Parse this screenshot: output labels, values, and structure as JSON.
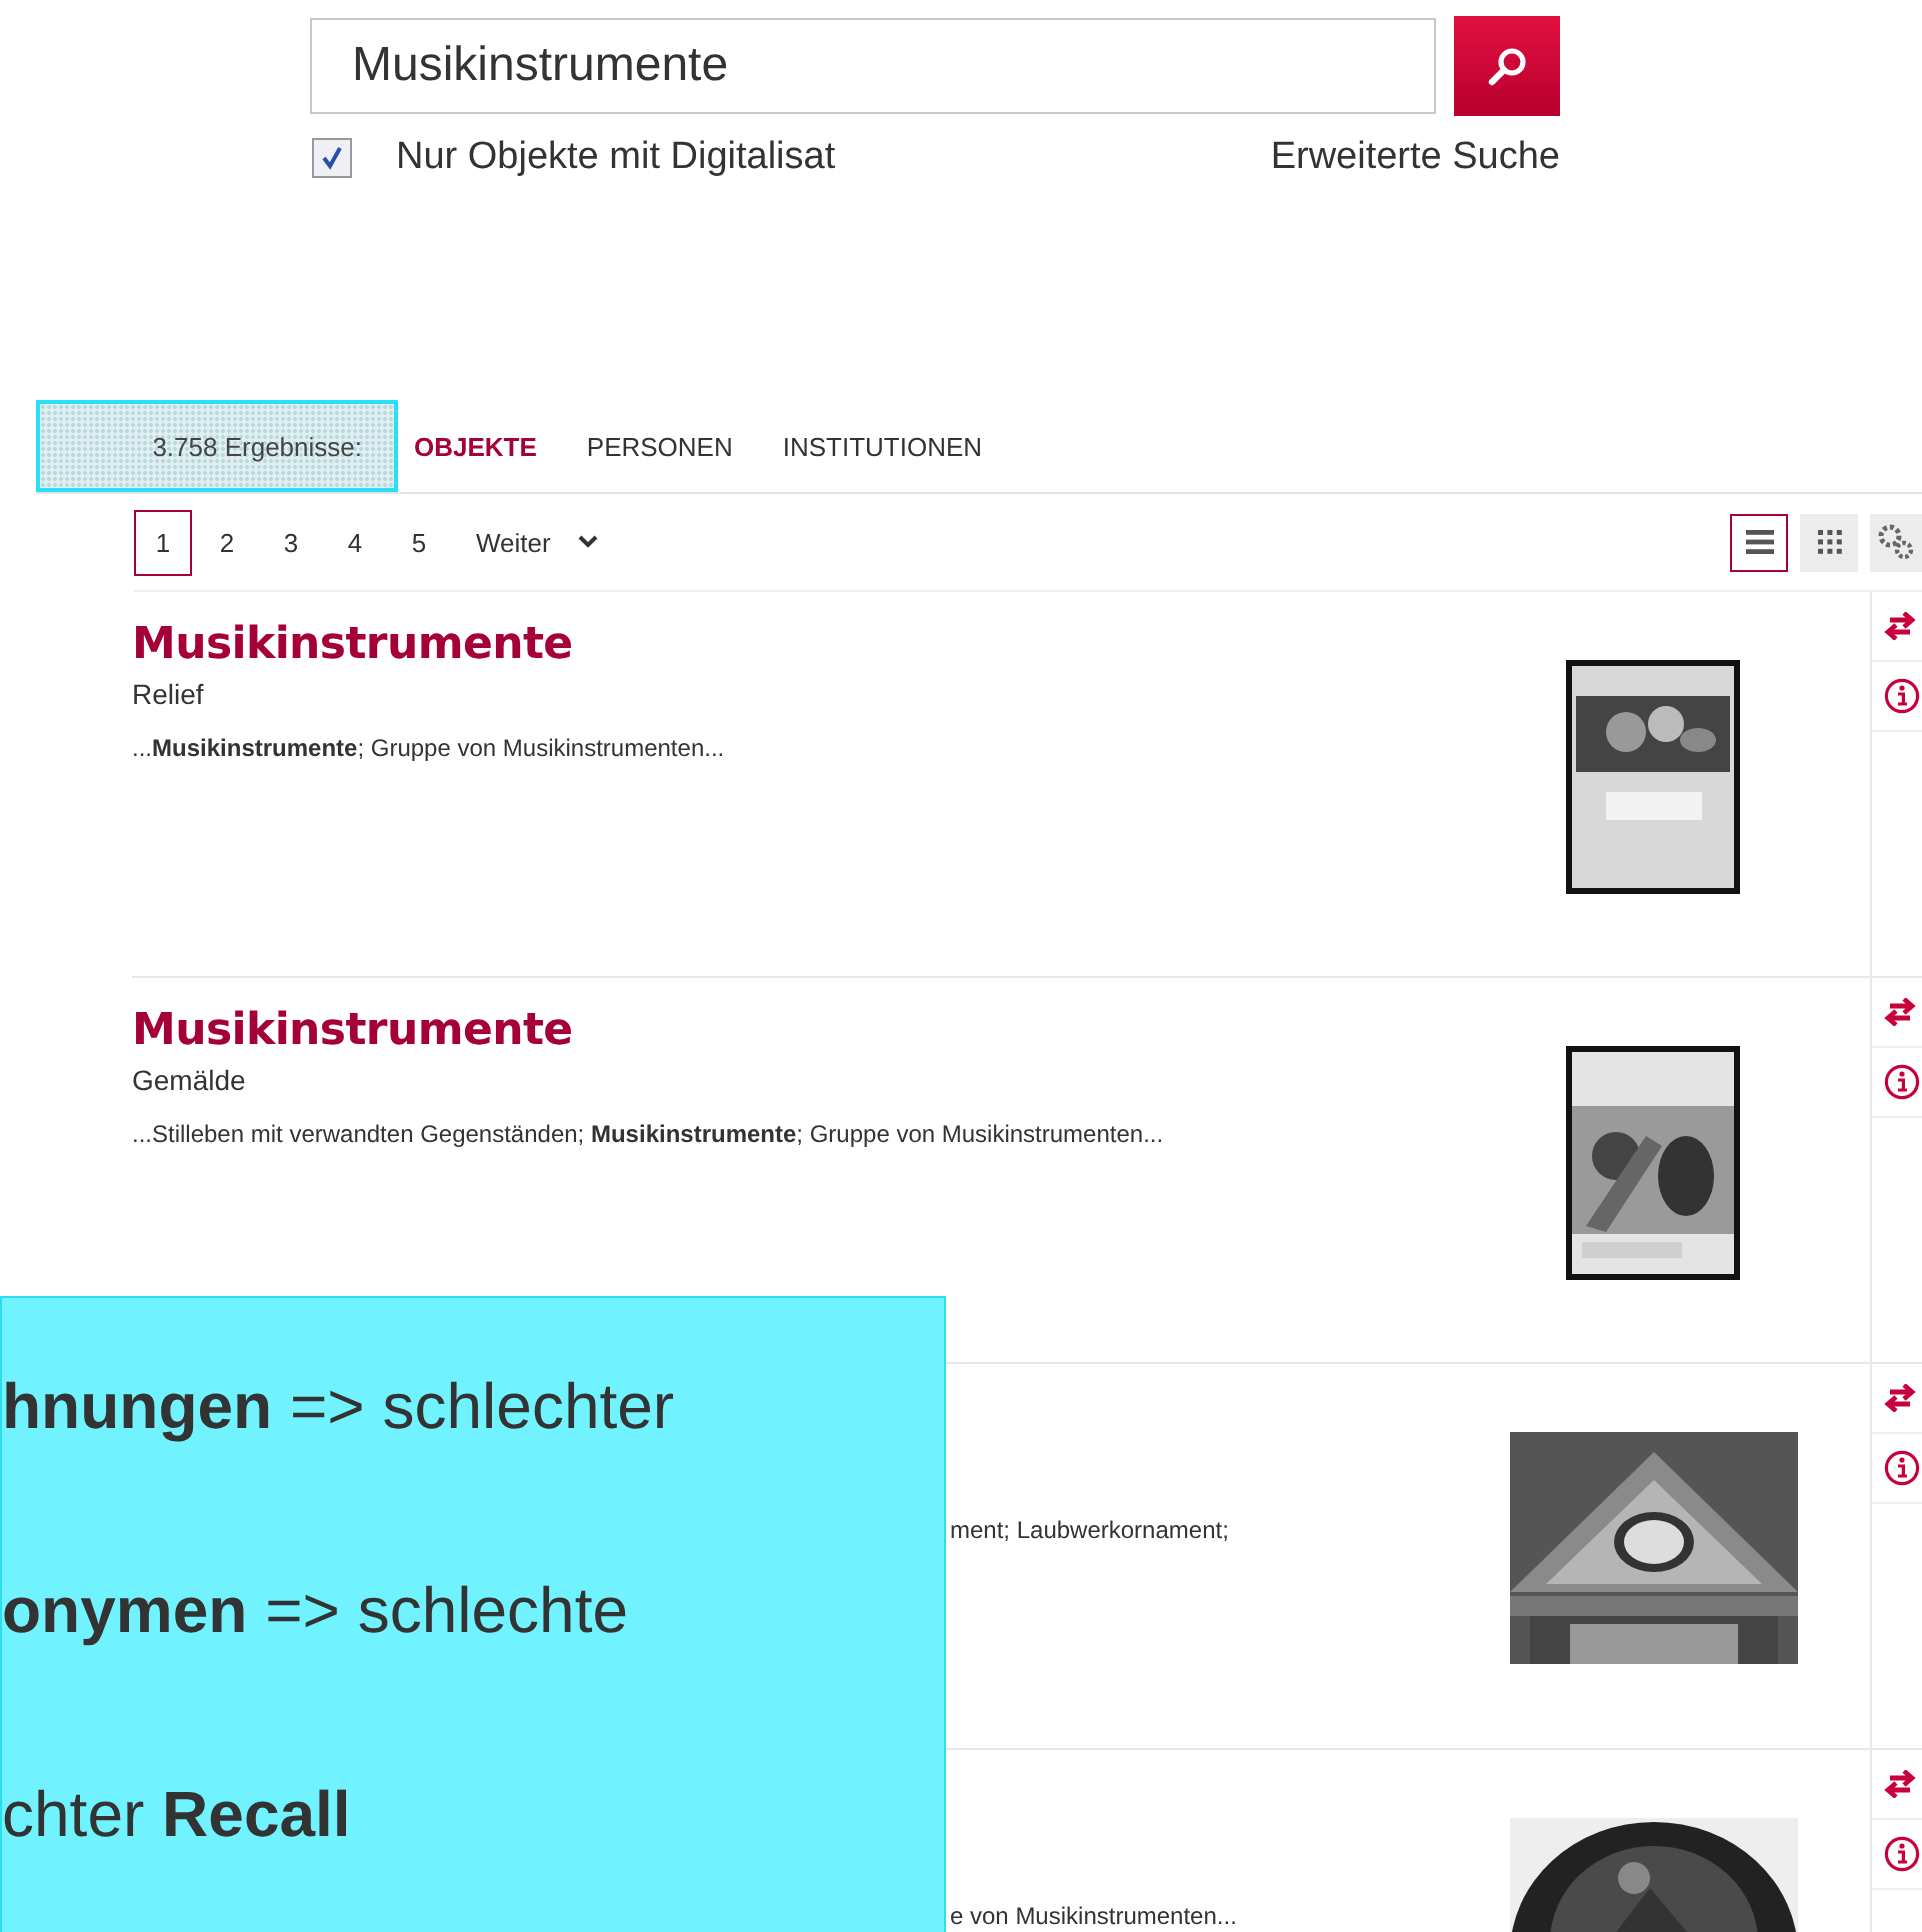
{
  "search": {
    "value": "Musikinstrumente",
    "digitized_only": {
      "label": "Nur Objekte mit Digitalisat",
      "checked": true
    },
    "advanced_link": "Erweiterte Suche"
  },
  "results_count": "3.758 Ergebnisse:",
  "tabs": [
    {
      "label": "OBJEKTE",
      "selected": true
    },
    {
      "label": "PERSONEN",
      "selected": false
    },
    {
      "label": "INSTITUTIONEN",
      "selected": false
    }
  ],
  "pagination": {
    "pages": [
      {
        "label": "1",
        "selected": true
      },
      {
        "label": "2",
        "selected": false
      },
      {
        "label": "3",
        "selected": false
      },
      {
        "label": "4",
        "selected": false
      },
      {
        "label": "5",
        "selected": false
      }
    ],
    "next": "Weiter"
  },
  "view_modes": [
    {
      "kind": "list",
      "selected": true
    },
    {
      "kind": "grid",
      "selected": false
    }
  ],
  "results": [
    {
      "kind": "full",
      "title": "Musikinstrumente",
      "type": "Relief",
      "snippet": "...**Musikinstrumente**; Gruppe von Musikinstrumenten..."
    },
    {
      "kind": "full",
      "title": "Musikinstrumente",
      "type": "Gemälde",
      "snippet": "...Stilleben mit verwandten Gegenständen; **Musikinstrumente**; Gruppe von Musikinstrumenten..."
    },
    {
      "kind": "covered",
      "snippet": "ment; Laubwerkornament;"
    },
    {
      "kind": "covered",
      "snippet": "e von Musikinstrumenten..."
    }
  ],
  "overlay": {
    "lines": [
      "**hnungen** => schlechter",
      "**onymen** => schlechte",
      "chter **Recall**"
    ]
  }
}
